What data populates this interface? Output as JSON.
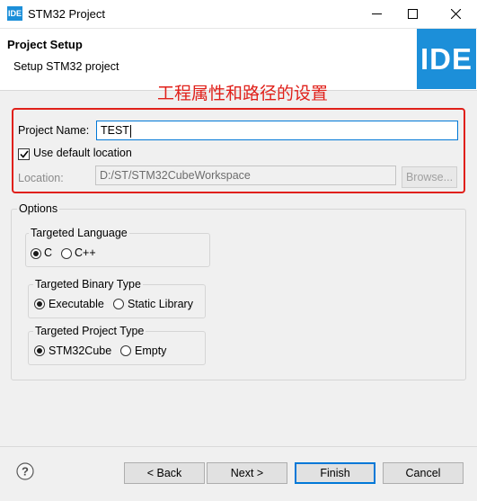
{
  "window": {
    "title": "STM32 Project",
    "app_icon_text": "IDE"
  },
  "header": {
    "title": "Project Setup",
    "subtitle": "Setup STM32 project",
    "logo_text": "IDE"
  },
  "annotation": {
    "text": "工程属性和路径的设置",
    "color": "#e0201a"
  },
  "project": {
    "name_label": "Project Name:",
    "name_value": "TEST",
    "use_default_label": "Use default location",
    "use_default_checked": true,
    "location_label": "Location:",
    "location_value": "D:/ST/STM32CubeWorkspace",
    "browse_label": "Browse..."
  },
  "options": {
    "title": "Options",
    "language": {
      "title": "Targeted Language",
      "options": [
        "C",
        "C++"
      ],
      "selected": "C"
    },
    "binary_type": {
      "title": "Targeted Binary Type",
      "options": [
        "Executable",
        "Static Library"
      ],
      "selected": "Executable"
    },
    "project_type": {
      "title": "Targeted Project Type",
      "options": [
        "STM32Cube",
        "Empty"
      ],
      "selected": "STM32Cube"
    }
  },
  "footer": {
    "help_icon": "question-mark-icon",
    "back_label": "< Back",
    "next_label": "Next >",
    "finish_label": "Finish",
    "cancel_label": "Cancel"
  },
  "colors": {
    "accent": "#1c8fd9",
    "focus": "#0078d7"
  }
}
